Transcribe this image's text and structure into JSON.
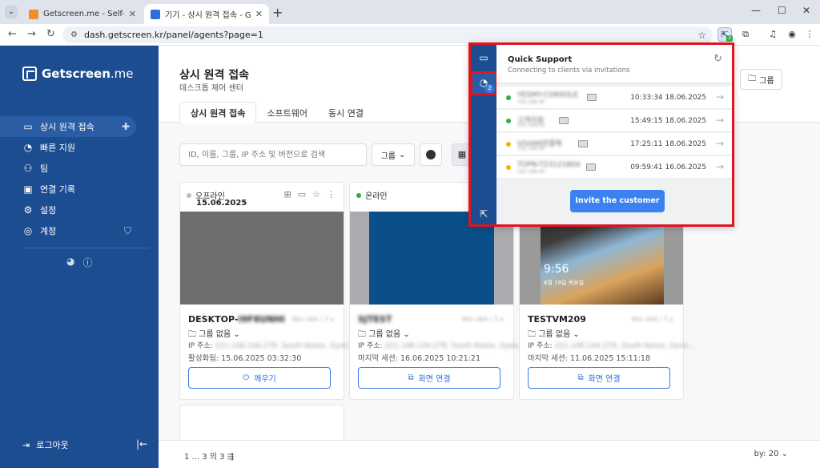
{
  "browser": {
    "tabs": [
      {
        "title": "Getscreen.me - Self-Hosted - I"
      },
      {
        "title": "기기 - 상시 원격 접속 - Getscre"
      }
    ],
    "url": "dash.getscreen.kr/panel/agents?page=1",
    "ext_badge": "3"
  },
  "sidebar": {
    "logo": "Getscreen",
    "logo_suffix": ".me",
    "items": [
      {
        "label": "상시 원격 접속",
        "icon": "devices-icon"
      },
      {
        "label": "빠른 지원",
        "icon": "support-icon"
      },
      {
        "label": "팀",
        "icon": "team-icon"
      },
      {
        "label": "연결 기록",
        "icon": "history-icon"
      },
      {
        "label": "설정",
        "icon": "gear-icon"
      },
      {
        "label": "계정",
        "icon": "account-icon"
      }
    ],
    "logout": "로그아웃"
  },
  "header": {
    "title": "상시 원격 접속",
    "subtitle": "데스크톱 제어 센터",
    "tabs": [
      "상시 원격 접속",
      "소프트웨어",
      "동시 연결"
    ],
    "group_button": "그룹"
  },
  "toolbar": {
    "search_placeholder": "ID, 이름, 그룹, IP 주소 및 버전으로 검색",
    "filter_label": "그룹"
  },
  "cards": [
    {
      "status": "오프라인",
      "status_color": "#b9bcc2",
      "date": "15.06.2025",
      "name": "DESKTOP-",
      "name_blur": "I9F8UNHI",
      "os": "Win x64 / 7.x",
      "group": "그룹 없음",
      "ip_label": "IP 주소:",
      "ip_value": "221.148.144.278, South Korea, Gyeo...",
      "last": "활성화됨: 15.06.2025 03:32:30",
      "action": "깨우기"
    },
    {
      "status": "온라인",
      "status_color": "#2fae4e",
      "date": "",
      "name": "",
      "name_blur": "SJTEST",
      "os": "Win x64 / 7.x",
      "group": "그룹 없음",
      "ip_label": "IP 주소:",
      "ip_value": "221.148.144.278, South Korea, Gyeo...",
      "last": "마지막 세션: 16.06.2025 10:21:21",
      "action": "화면 연결"
    },
    {
      "status": "",
      "status_color": "#2fae4e",
      "date": "",
      "name": "TESTVM209",
      "name_blur": "",
      "os": "Win x64 / 7.x",
      "group": "그룹 없음",
      "ip_label": "IP 주소:",
      "ip_value": "221.148.144.278, South Korea, Gyeo...",
      "last": "마지막 세션: 11.06.2025 15:11:18",
      "action": "화면 연결",
      "lock_time": "9:56",
      "lock_date": "6월 19일 목요일"
    }
  ],
  "footer": {
    "pagination": "1 ... 3 의 3",
    "per_page_label": "by:",
    "per_page": "20"
  },
  "popup": {
    "title": "Quick Support",
    "subtitle": "Connecting to clients via invitations",
    "badge": "2",
    "rows": [
      {
        "name": "YESMY-CONSOLE",
        "sub": "192.168.40",
        "time": "10:33:34 18.06.2025",
        "color": "#2fae4e"
      },
      {
        "name": "고객지원",
        "sub": "192.168.40",
        "time": "15:49:15 18.06.2025",
        "color": "#2fae4e"
      },
      {
        "name": "VIVIAN연결체",
        "sub": "192.168.40",
        "time": "17:25:11 18.06.2025",
        "color": "#f0b400"
      },
      {
        "name": "TOPN-T23121804",
        "sub": "192.168.40",
        "time": "09:59:41 16.06.2025",
        "color": "#f0b400"
      }
    ],
    "invite_button": "Invite the customer"
  }
}
